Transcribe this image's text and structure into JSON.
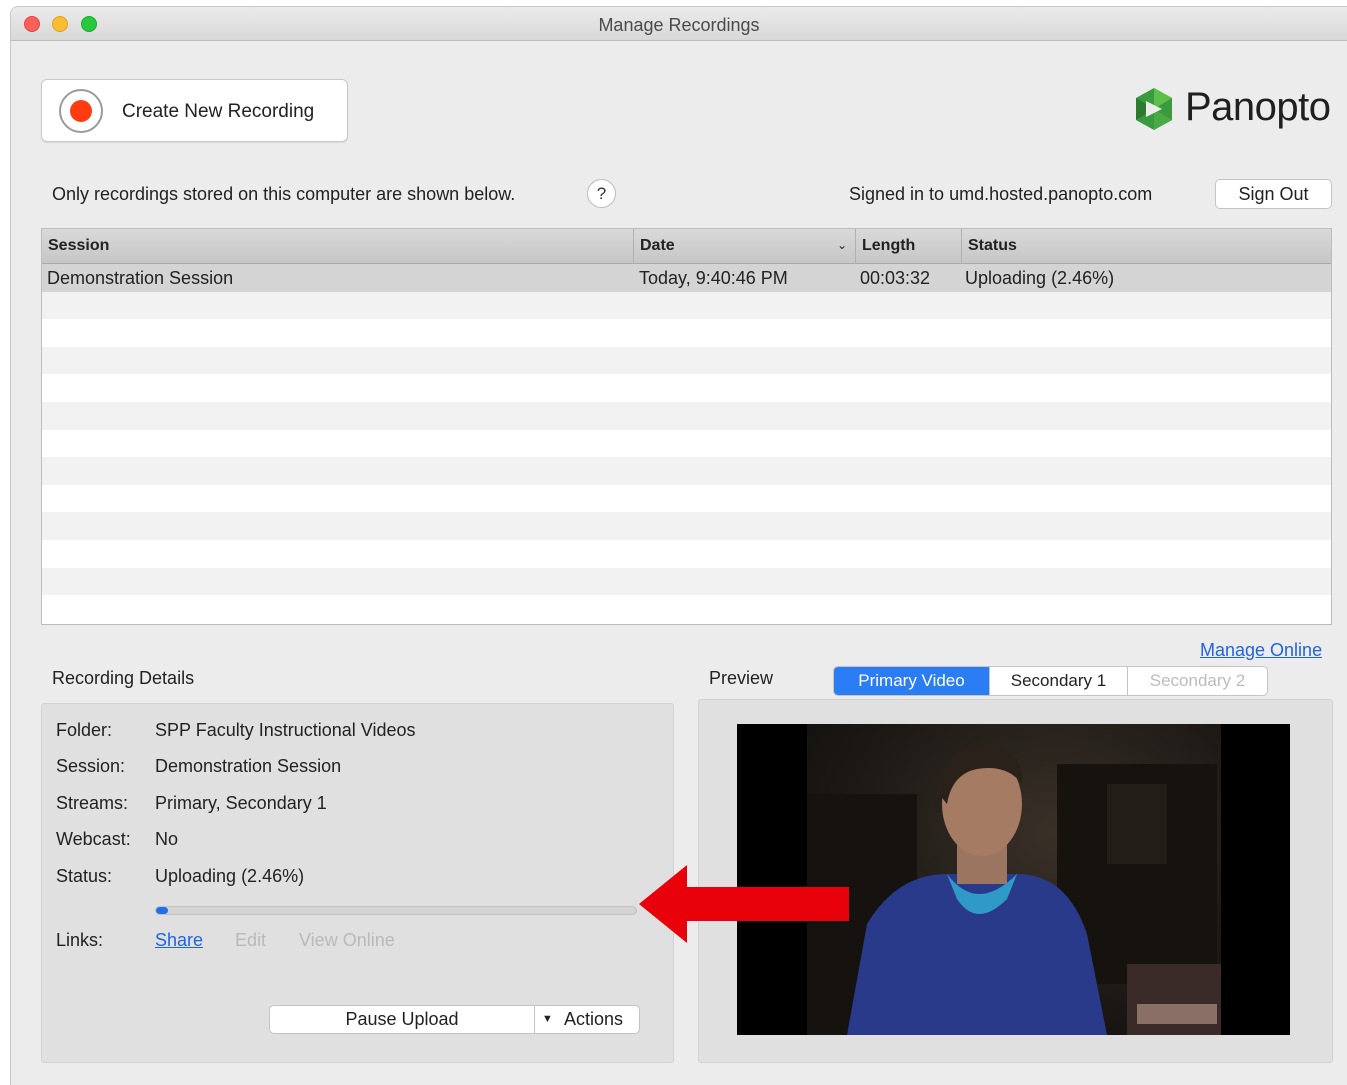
{
  "window": {
    "title": "Manage Recordings"
  },
  "toolbar": {
    "create_label": "Create New Recording"
  },
  "brand": {
    "name": "Panopto",
    "colors": [
      "#34a853",
      "#4caf50",
      "#2e7d32"
    ]
  },
  "info": {
    "note": "Only recordings stored on this computer are shown below.",
    "help": "?",
    "signed_in": "Signed in to umd.hosted.panopto.com",
    "sign_out": "Sign Out"
  },
  "table": {
    "columns": [
      "Session",
      "Date",
      "Length",
      "Status"
    ],
    "sort_column": "Date",
    "rows": [
      {
        "session": "Demonstration Session",
        "date": "Today, 9:40:46 PM",
        "length": "00:03:32",
        "status": "Uploading (2.46%)"
      }
    ]
  },
  "manage_online": "Manage Online",
  "details": {
    "heading": "Recording Details",
    "fields": [
      {
        "label": "Folder:",
        "value": "SPP Faculty Instructional Videos"
      },
      {
        "label": "Session:",
        "value": "Demonstration Session"
      },
      {
        "label": "Streams:",
        "value": "Primary, Secondary 1"
      },
      {
        "label": "Webcast:",
        "value": "No"
      },
      {
        "label": "Status:",
        "value": "Uploading (2.46%)"
      }
    ],
    "upload_progress_percent": 2.46,
    "links_label": "Links:",
    "links": {
      "share": "Share",
      "edit": "Edit",
      "view_online": "View Online"
    },
    "pause_label": "Pause Upload",
    "actions_label": "Actions"
  },
  "preview": {
    "heading": "Preview",
    "tabs": [
      "Primary Video",
      "Secondary 1",
      "Secondary 2"
    ],
    "active_tab": "Primary Video",
    "disabled_tab": "Secondary 2"
  },
  "annotation": {
    "arrow_color": "#e8000a"
  }
}
